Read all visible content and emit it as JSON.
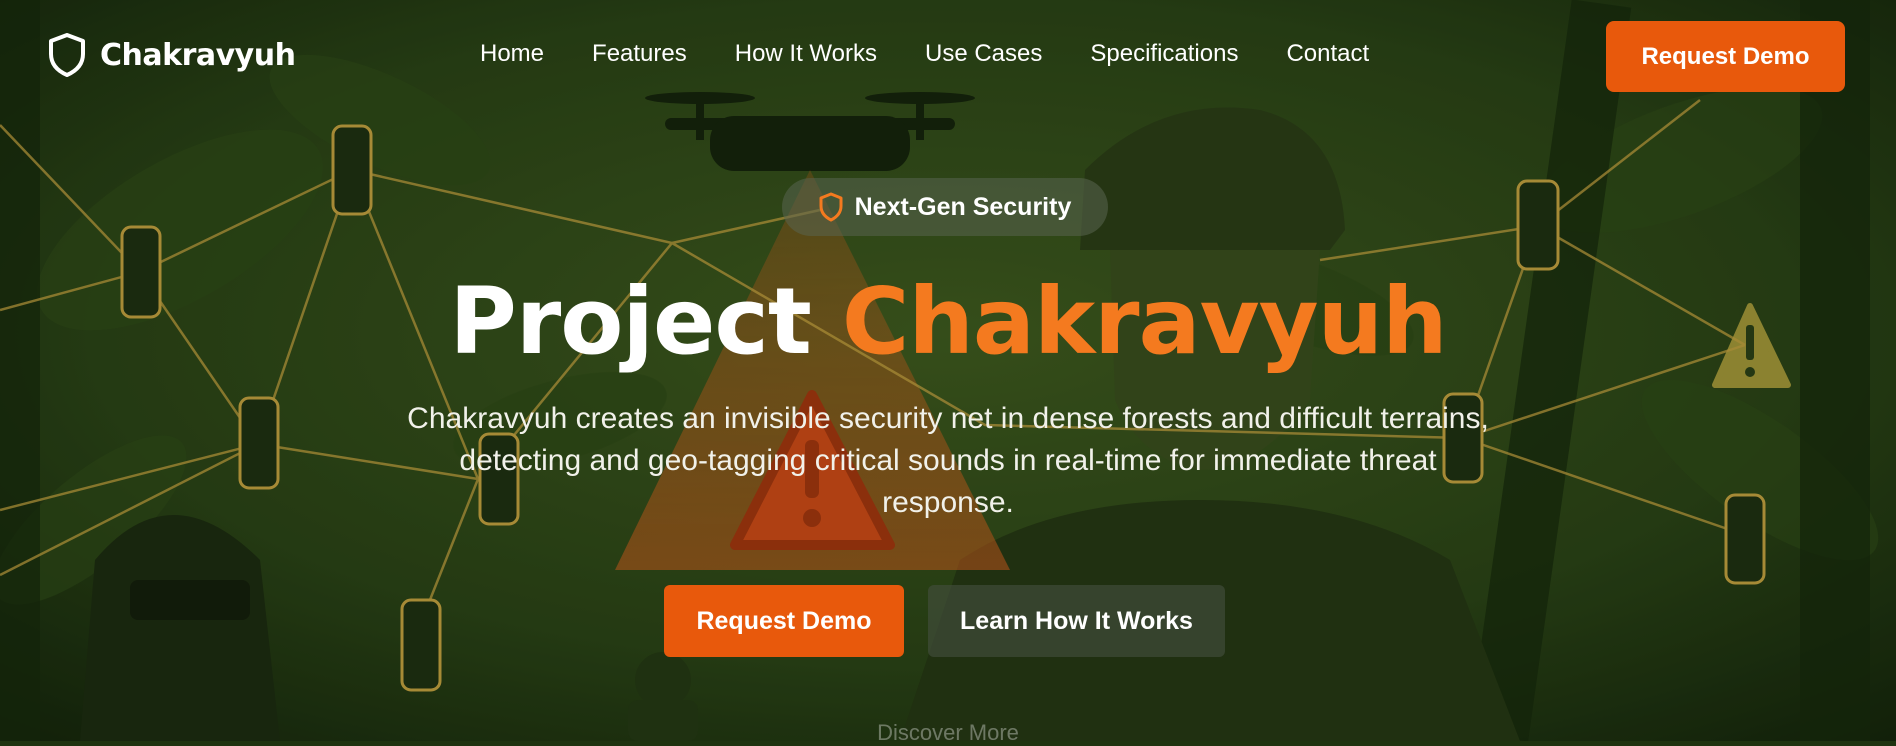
{
  "brand": {
    "name": "Chakravyuh",
    "logo_icon": "shield-icon"
  },
  "nav": {
    "links": [
      "Home",
      "Features",
      "How It Works",
      "Use Cases",
      "Specifications",
      "Contact"
    ],
    "cta_label": "Request Demo"
  },
  "hero": {
    "badge": {
      "icon": "shield-icon",
      "label": "Next-Gen Security"
    },
    "title_prefix": "Project",
    "title_accent": "Chakravyuh",
    "subtitle": "Chakravyuh creates an invisible security net in dense forests and difficult terrains, detecting and geo-tagging critical sounds in real-time for immediate threat response.",
    "primary_button": "Request Demo",
    "secondary_button": "Learn How It Works",
    "scroll_hint": "Discover More"
  },
  "colors": {
    "accent": "#e8590c",
    "accent_text": "#f47a1f",
    "background": "#1f3310",
    "network_line": "#c9a441"
  }
}
